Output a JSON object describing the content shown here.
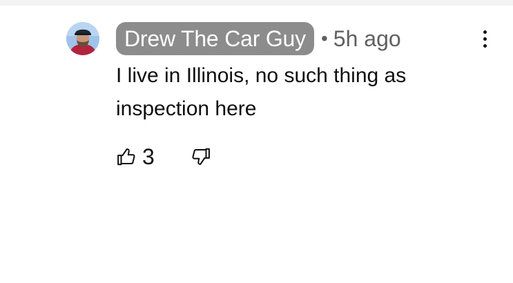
{
  "comment": {
    "author": "Drew The Car Guy",
    "separator": "•",
    "timestamp": "5h ago",
    "text": "I live in Illinois, no such thing as inspection here",
    "like_count": "3",
    "icons": {
      "more": "more-vertical-icon",
      "like": "thumbs-up-icon",
      "dislike": "thumbs-down-icon"
    }
  },
  "colors": {
    "author_badge_bg": "#8c8c8c",
    "author_badge_text": "#ffffff",
    "secondary_text": "#606060",
    "primary_text": "#0f0f0f"
  }
}
